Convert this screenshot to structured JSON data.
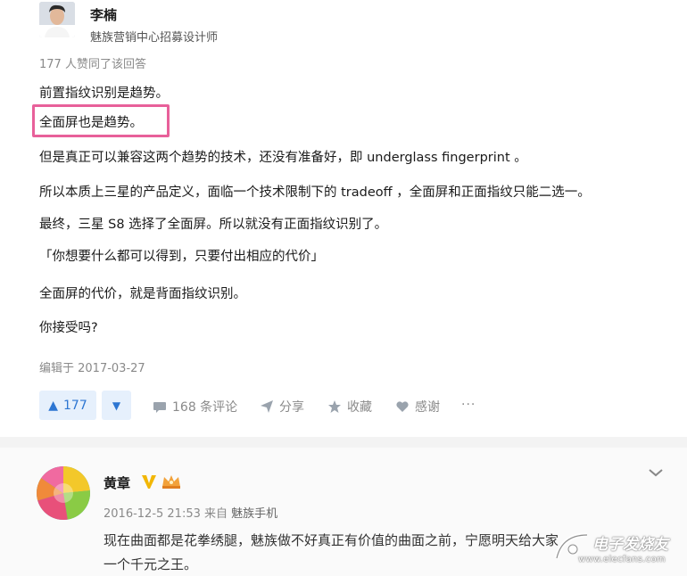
{
  "answer": {
    "author_name": "李楠",
    "author_title": "魅族营销中心招募设计师",
    "agree_text": "177 人赞同了该回答",
    "paragraphs": [
      "前置指纹识别是趋势。",
      "全面屏也是趋势。",
      "但是真正可以兼容这两个趋势的技术，还没有准备好，即 underglass fingerprint 。",
      "所以本质上三星的产品定义，面临一个技术限制下的 tradeoff ，全面屏和正面指纹只能二选一。",
      "最终，三星 S8 选择了全面屏。所以就没有正面指纹识别了。",
      "「你想要什么都可以得到，只要付出相应的代价」",
      "全面屏的代价，就是背面指纹识别。",
      "你接受吗?"
    ],
    "edited": "编辑于 2017-03-27",
    "actions": {
      "vote_count": "177",
      "comments": "168 条评论",
      "share": "分享",
      "favorite": "收藏",
      "thanks": "感谢",
      "more": "···"
    }
  },
  "weibo": {
    "name": "黄章",
    "date": "2016-12-5 21:53",
    "via": "来自",
    "source": "魅族手机",
    "text_lines": [
      "现在曲面都是花拳绣腿，魅族做不好真正有价值的曲面之前，宁愿明天给大家",
      "一个千元之王。"
    ]
  },
  "watermark": {
    "brand": "电子发烧友",
    "url": "www.elecfans.com"
  },
  "colors": {
    "highlight_border": "#e8609a",
    "vote_blue": "#2d76d2",
    "vote_bg": "#e6f0fc",
    "verified_gold": "#f2b705"
  }
}
